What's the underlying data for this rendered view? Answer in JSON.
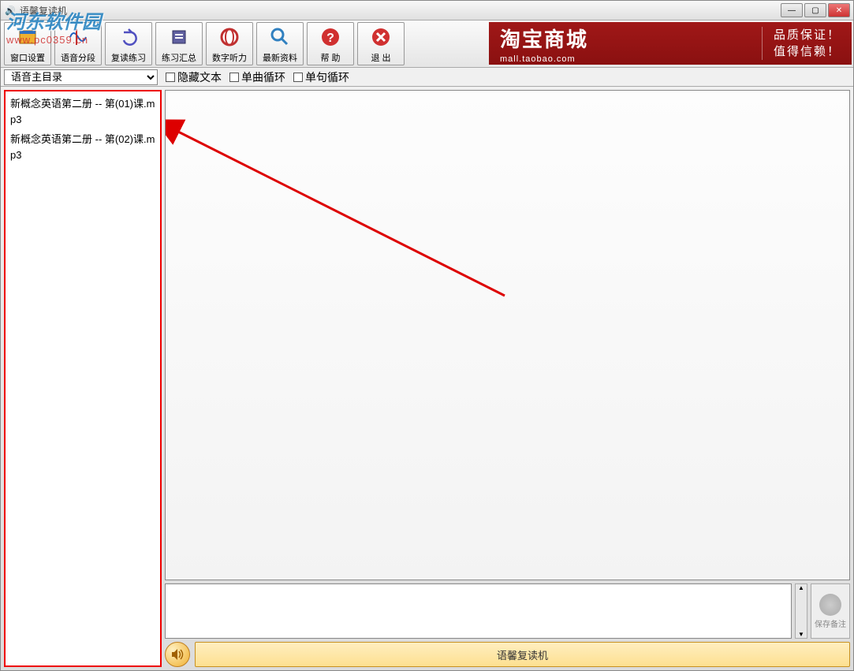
{
  "window": {
    "title": "语馨复读机"
  },
  "toolbar": {
    "window_settings": "窗口设置",
    "audio_segment": "语音分段",
    "repeat_practice": "复读练习",
    "practice_summary": "练习汇总",
    "number_listen": "数字听力",
    "latest_material": "最新资料",
    "help": "帮 助",
    "exit": "退 出"
  },
  "banner": {
    "logo": "淘宝商城",
    "sub": "mall.taobao.com",
    "slogan1": "品质保证！",
    "slogan2": "值得信赖！"
  },
  "options": {
    "dir_label": "语音主目录",
    "hide_text": "隐藏文本",
    "single_loop": "单曲循环",
    "sentence_loop": "单句循环"
  },
  "files": [
    "新概念英语第二册 -- 第(01)课.mp3",
    "新概念英语第二册 -- 第(02)课.mp3"
  ],
  "save_note": "保存备注",
  "bottom_status": "语馨复读机",
  "watermark": {
    "text": "河东软件园",
    "url": "www.pc0359.cn"
  }
}
